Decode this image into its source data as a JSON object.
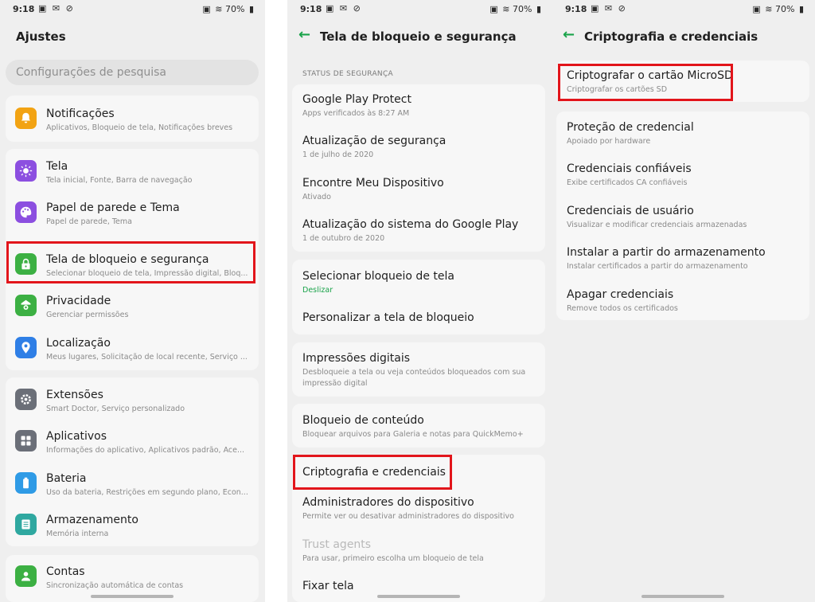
{
  "status": {
    "time": "9:18",
    "battery": "70%"
  },
  "screen1": {
    "title": "Ajustes",
    "search_placeholder": "Configurações de pesquisa",
    "items": [
      {
        "title": "Notificações",
        "sub": "Aplicativos, Bloqueio de tela, Notificações breves",
        "icon": "bell-icon",
        "color": "#f2a313"
      },
      {
        "title": "Tela",
        "sub": "Tela inicial, Fonte, Barra de navegação",
        "icon": "brightness-icon",
        "color": "#8c4fe0"
      },
      {
        "title": "Papel de parede e Tema",
        "sub": "Papel de parede, Tema",
        "icon": "palette-icon",
        "color": "#8c4fe0"
      },
      {
        "title": "Tela de bloqueio e segurança",
        "sub": "Selecionar bloqueio de tela, Impressão digital, Bloq...",
        "icon": "lock-icon",
        "color": "#3cb043"
      },
      {
        "title": "Privacidade",
        "sub": "Gerenciar permissões",
        "icon": "privacy-icon",
        "color": "#3cb043"
      },
      {
        "title": "Localização",
        "sub": "Meus lugares, Solicitação de local recente, Serviço ...",
        "icon": "location-icon",
        "color": "#2f7fe6"
      },
      {
        "title": "Extensões",
        "sub": "Smart Doctor, Serviço personalizado",
        "icon": "gear-icon",
        "color": "#6b6f78"
      },
      {
        "title": "Aplicativos",
        "sub": "Informações do aplicativo, Aplicativos padrão, Ace...",
        "icon": "apps-icon",
        "color": "#6b6f78"
      },
      {
        "title": "Bateria",
        "sub": "Uso da bateria, Restrições em segundo plano, Econ...",
        "icon": "battery-icon",
        "color": "#2f9be6"
      },
      {
        "title": "Armazenamento",
        "sub": "Memória interna",
        "icon": "storage-icon",
        "color": "#2fa8a0"
      },
      {
        "title": "Contas",
        "sub": "Sincronização automática de contas",
        "icon": "account-icon",
        "color": "#3cb043"
      }
    ]
  },
  "screen2": {
    "title": "Tela de bloqueio e segurança",
    "section": "STATUS DE SEGURANÇA",
    "items": [
      {
        "title": "Google Play Protect",
        "sub": "Apps verificados às 8:27 AM"
      },
      {
        "title": "Atualização de segurança",
        "sub": "1 de julho de 2020"
      },
      {
        "title": "Encontre Meu Dispositivo",
        "sub": "Ativado"
      },
      {
        "title": "Atualização do sistema do Google Play",
        "sub": "1 de outubro de 2020"
      },
      {
        "title": "Selecionar bloqueio de tela",
        "sub": "Deslizar"
      },
      {
        "title": "Personalizar a tela de bloqueio",
        "sub": ""
      },
      {
        "title": "Impressões digitais",
        "sub": "Desbloqueie a tela ou veja conteúdos bloqueados com sua",
        "sub2": "impressão digital"
      },
      {
        "title": "Bloqueio de conteúdo",
        "sub": "Bloquear arquivos para Galeria e notas para QuickMemo+"
      },
      {
        "title": "Criptografia e credenciais",
        "sub": ""
      },
      {
        "title": "Administradores do dispositivo",
        "sub": "Permite ver ou desativar administradores do dispositivo"
      },
      {
        "title": "Trust agents",
        "sub": "Para usar, primeiro escolha um bloqueio de tela"
      },
      {
        "title": "Fixar tela",
        "sub": ""
      }
    ]
  },
  "screen3": {
    "title": "Criptografia e credenciais",
    "items": [
      {
        "title": "Criptografar o cartão MicroSD",
        "sub": "Criptografar os cartões SD"
      },
      {
        "title": "Proteção de credencial",
        "sub": "Apoiado por hardware"
      },
      {
        "title": "Credenciais confiáveis",
        "sub": "Exibe certificados CA confiáveis"
      },
      {
        "title": "Credenciais de usuário",
        "sub": "Visualizar e modificar credenciais armazenadas"
      },
      {
        "title": "Instalar a partir do armazenamento",
        "sub": "Instalar certificados a partir do armazenamento"
      },
      {
        "title": "Apagar credenciais",
        "sub": "Remove todos os certificados"
      }
    ]
  }
}
